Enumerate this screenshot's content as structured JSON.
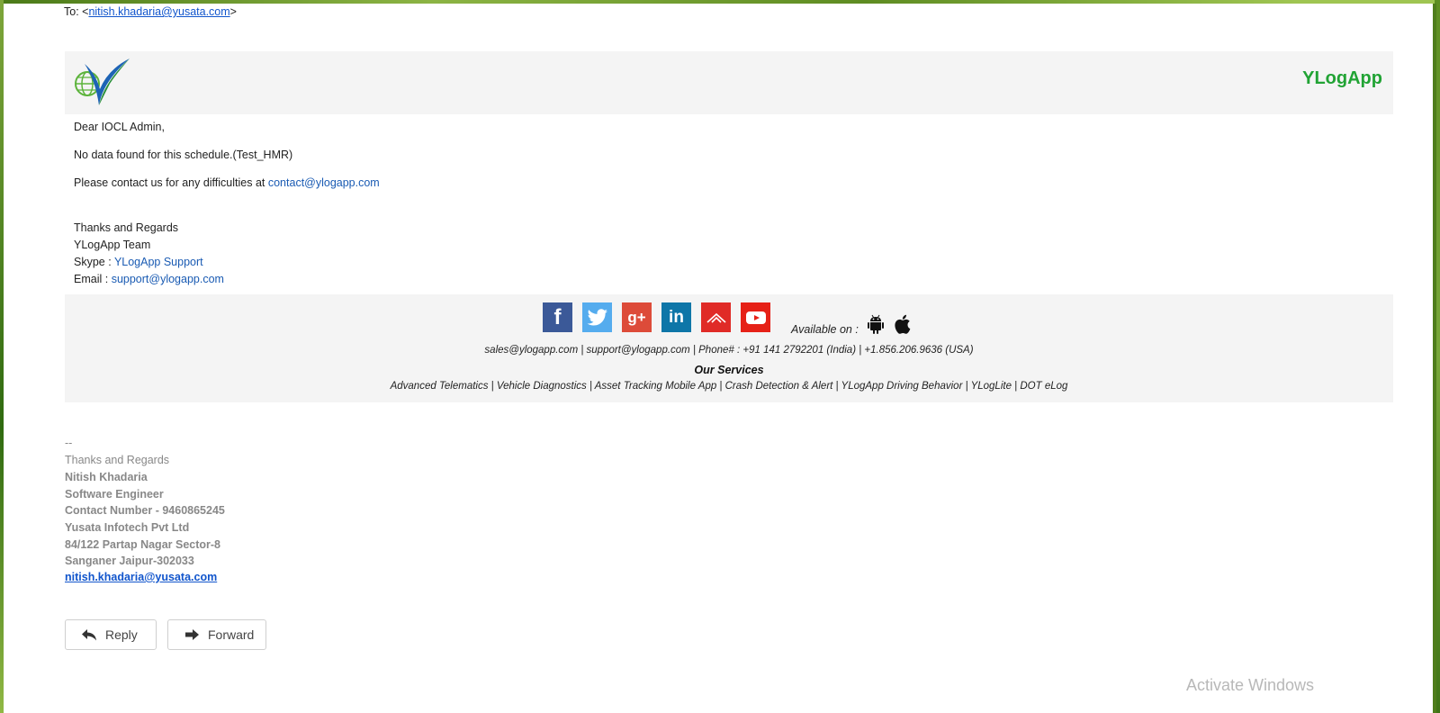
{
  "email": {
    "to_prefix": "To: <",
    "to_address": "nitish.khadaria@yusata.com",
    "to_suffix": ">"
  },
  "header": {
    "brand": "YLogApp"
  },
  "message": {
    "greeting": "Dear IOCL Admin,",
    "body": "No data found for this schedule.(Test_HMR)",
    "contact_prefix": "Please contact us for any difficulties at ",
    "contact_email": "contact@ylogapp.com",
    "regards": "Thanks and Regards",
    "team": "YLogApp Team",
    "skype_label": "Skype : ",
    "skype_value": "YLogApp Support",
    "email_label": "Email : ",
    "email_value": "support@ylogapp.com"
  },
  "footer": {
    "social_icons": [
      "facebook-icon",
      "twitter-icon",
      "google-plus-icon",
      "linkedin-icon",
      "ylog-mountain-icon",
      "youtube-icon"
    ],
    "available_on": "Available on :",
    "platform_icons": [
      "android-icon",
      "apple-icon"
    ],
    "contacts": "sales@ylogapp.com | support@ylogapp.com | Phone# : +91 141 2792201 (India) | +1.856.206.9636 (USA)",
    "services_title": "Our Services",
    "services": "Advanced Telematics | Vehicle Diagnostics | Asset Tracking Mobile App | Crash Detection & Alert | YLogApp Driving Behavior | YLogLite | DOT eLog"
  },
  "signature": {
    "dashes": "--",
    "regards": "Thanks and Regards",
    "name": "Nitish Khadaria",
    "title": "Software Engineer",
    "phone": "Contact Number - 9460865245",
    "company": "Yusata Infotech Pvt Ltd",
    "address1": "84/122 Partap Nagar Sector-8",
    "address2": "Sanganer Jaipur-302033",
    "email": "nitish.khadaria@yusata.com"
  },
  "actions": {
    "reply_label": "Reply",
    "forward_label": "Forward"
  },
  "os": {
    "watermark": "Activate Windows"
  },
  "colors": {
    "brand_green": "#21a334",
    "link_blue": "#1a5bb3",
    "panel_gray": "#f4f4f4"
  }
}
